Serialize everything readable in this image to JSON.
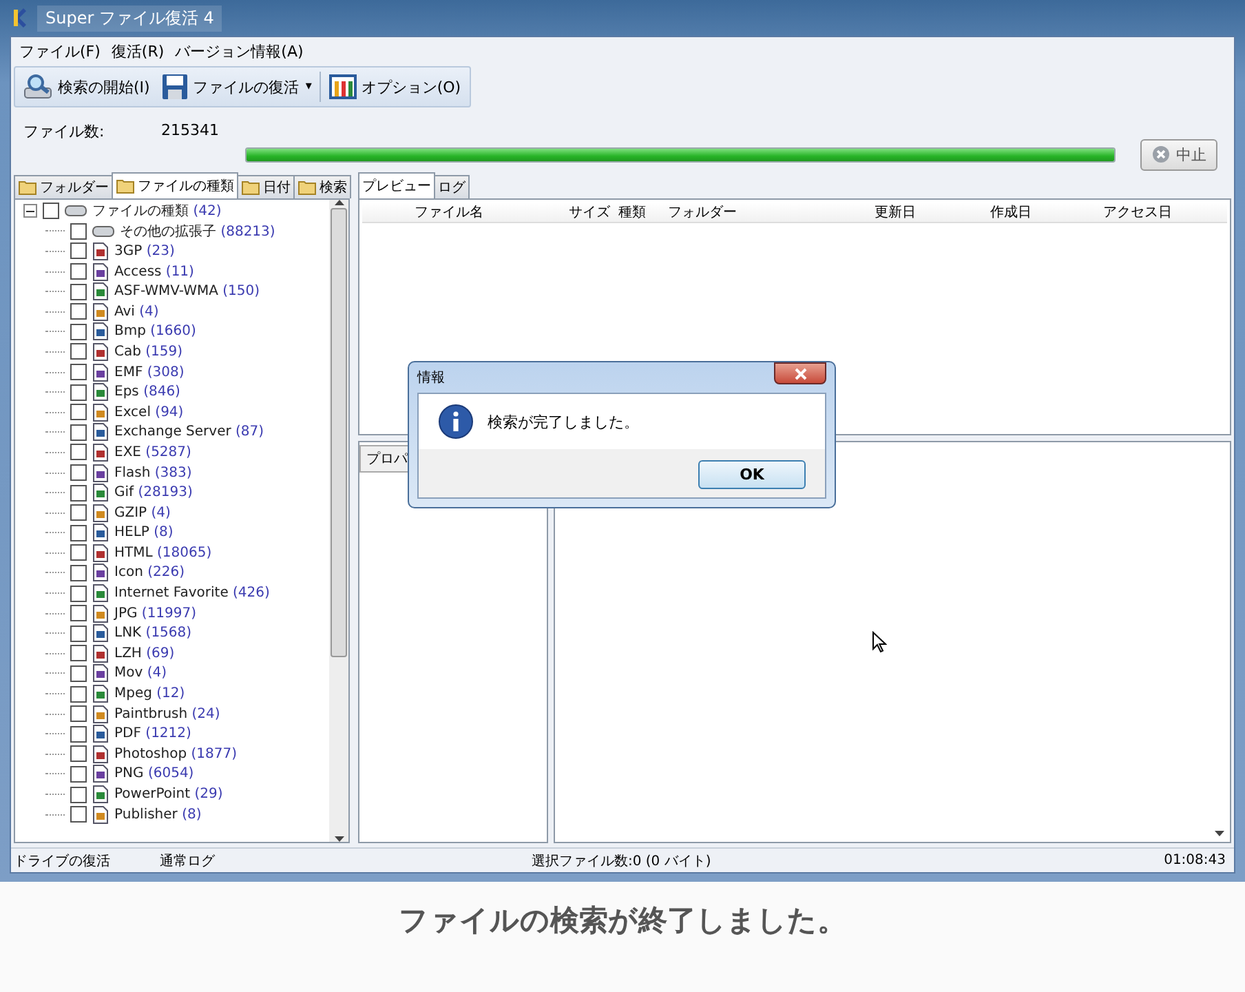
{
  "window": {
    "title": "Super ファイル復活 4"
  },
  "menu": [
    "ファイル(F)",
    "復活(R)",
    "バージョン情報(A)"
  ],
  "toolbar": [
    {
      "label": "検索の開始(I)",
      "kind": "search"
    },
    {
      "label": "ファイルの復活",
      "kind": "save-dropdown",
      "caret": "▾"
    },
    {
      "label": "オプション(O)",
      "kind": "options"
    }
  ],
  "file_count": {
    "label": "ファイル数:",
    "value": "215341"
  },
  "progress": {
    "level": 1
  },
  "stop_button": {
    "label": "中止"
  },
  "left_tabs": [
    {
      "label": "フォルダー",
      "selected": false
    },
    {
      "label": "ファイルの種類",
      "selected": true
    },
    {
      "label": "日付",
      "selected": false
    },
    {
      "label": "検索",
      "selected": false
    }
  ],
  "tree": {
    "label": "ファイルの種類",
    "count": "(42)",
    "expanded": true,
    "checked": false,
    "children": [
      {
        "label": "その他の拡張子",
        "count": "(88213)",
        "checked": false
      },
      {
        "label": "3GP",
        "count": "(23)",
        "checked": false
      },
      {
        "label": "Access",
        "count": "(11)",
        "checked": false
      },
      {
        "label": "ASF-WMV-WMA",
        "count": "(150)",
        "checked": false
      },
      {
        "label": "Avi",
        "count": "(4)",
        "checked": false
      },
      {
        "label": "Bmp",
        "count": "(1660)",
        "checked": false
      },
      {
        "label": "Cab",
        "count": "(159)",
        "checked": false
      },
      {
        "label": "EMF",
        "count": "(308)",
        "checked": false
      },
      {
        "label": "Eps",
        "count": "(846)",
        "checked": false
      },
      {
        "label": "Excel",
        "count": "(94)",
        "checked": false
      },
      {
        "label": "Exchange Server",
        "count": "(87)",
        "checked": false
      },
      {
        "label": "EXE",
        "count": "(5287)",
        "checked": false
      },
      {
        "label": "Flash",
        "count": "(383)",
        "checked": false
      },
      {
        "label": "Gif",
        "count": "(28193)",
        "checked": false
      },
      {
        "label": "GZIP",
        "count": "(4)",
        "checked": false
      },
      {
        "label": "HELP",
        "count": "(8)",
        "checked": false
      },
      {
        "label": "HTML",
        "count": "(18065)",
        "checked": false
      },
      {
        "label": "Icon",
        "count": "(226)",
        "checked": false
      },
      {
        "label": "Internet Favorite",
        "count": "(426)",
        "checked": false
      },
      {
        "label": "JPG",
        "count": "(11997)",
        "checked": false
      },
      {
        "label": "LNK",
        "count": "(1568)",
        "checked": false
      },
      {
        "label": "LZH",
        "count": "(69)",
        "checked": false
      },
      {
        "label": "Mov",
        "count": "(4)",
        "checked": false
      },
      {
        "label": "Mpeg",
        "count": "(12)",
        "checked": false
      },
      {
        "label": "Paintbrush",
        "count": "(24)",
        "checked": false
      },
      {
        "label": "PDF",
        "count": "(1212)",
        "checked": false
      },
      {
        "label": "Photoshop",
        "count": "(1877)",
        "checked": false
      },
      {
        "label": "PNG",
        "count": "(6054)",
        "checked": false
      },
      {
        "label": "PowerPoint",
        "count": "(29)",
        "checked": false
      },
      {
        "label": "Publisher",
        "count": "(8)",
        "checked": false
      }
    ]
  },
  "right_tabs": [
    {
      "label": "プレビュー",
      "selected": true
    },
    {
      "label": "ログ",
      "selected": false
    }
  ],
  "table": {
    "columns": [
      "ファイル名",
      "サイズ",
      "種類",
      "フォルダー",
      "更新日",
      "作成日",
      "アクセス日"
    ]
  },
  "lower_tab": {
    "label": "プロパ"
  },
  "dialog": {
    "title": "情報",
    "message": "検索が完了しました。",
    "button": "OK"
  },
  "status_bar": [
    "ドライブの復活",
    "通常ログ",
    "選択ファイル数:0 (0 バイト)",
    "01:08:43"
  ],
  "caption": "ファイルの検索が終了しました。"
}
